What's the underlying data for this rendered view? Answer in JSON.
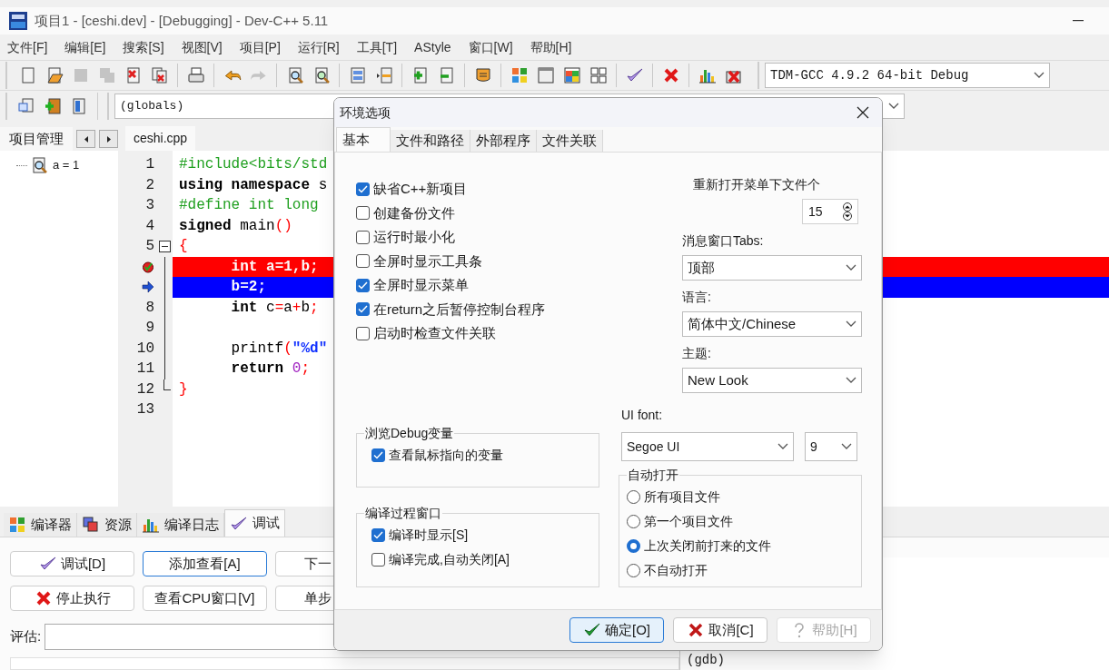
{
  "window": {
    "title": "项目1 - [ceshi.dev] - [Debugging] - Dev-C++ 5.11"
  },
  "menu": [
    "文件[F]",
    "编辑[E]",
    "搜索[S]",
    "视图[V]",
    "项目[P]",
    "运行[R]",
    "工具[T]",
    "AStyle",
    "窗口[W]",
    "帮助[H]"
  ],
  "toolbar_main": {
    "groups": [
      [
        {
          "kind": "new",
          "disabled": false
        },
        {
          "kind": "open",
          "disabled": false
        },
        {
          "kind": "save",
          "disabled": true
        },
        {
          "kind": "save-all",
          "disabled": true
        },
        {
          "kind": "close",
          "disabled": false
        },
        {
          "kind": "close-all",
          "disabled": false
        }
      ],
      [
        {
          "kind": "print",
          "disabled": false
        }
      ],
      [
        {
          "kind": "undo",
          "disabled": false
        },
        {
          "kind": "redo",
          "disabled": true
        }
      ],
      [
        {
          "kind": "find",
          "disabled": false
        },
        {
          "kind": "replace",
          "disabled": false
        }
      ],
      [
        {
          "kind": "panel",
          "disabled": false
        },
        {
          "kind": "split",
          "disabled": false
        }
      ],
      [
        {
          "kind": "add",
          "disabled": false
        },
        {
          "kind": "remove",
          "disabled": false
        }
      ],
      [
        {
          "kind": "bookmark",
          "disabled": false
        }
      ],
      [
        {
          "kind": "grid",
          "disabled": false
        },
        {
          "kind": "window",
          "disabled": false
        },
        {
          "kind": "colors",
          "disabled": false
        },
        {
          "kind": "tiles",
          "disabled": false
        }
      ],
      [
        {
          "kind": "check",
          "disabled": false
        }
      ],
      [
        {
          "kind": "cross",
          "disabled": false
        }
      ],
      [
        {
          "kind": "chart",
          "disabled": false
        },
        {
          "kind": "chart-cross",
          "disabled": false
        }
      ]
    ],
    "compiler_select": {
      "value": "TDM-GCC 4.9.2 64-bit Debug"
    }
  },
  "toolbar_secondary": {
    "buttons": [
      {
        "kind": "copy"
      },
      {
        "kind": "add-orange"
      },
      {
        "kind": "panel-blue"
      }
    ],
    "scope_select": {
      "value": "(globals)"
    }
  },
  "project_panel": {
    "tab": "项目管理",
    "watch_items": [
      {
        "label": "a = 1"
      }
    ]
  },
  "editor": {
    "tabs": [
      {
        "label": "ceshi.cpp",
        "selected": true
      }
    ],
    "lines": [
      {
        "kind": "normal",
        "number": "1",
        "segments": [
          {
            "kind": "preprocessor",
            "text": "#include<bits/std"
          }
        ]
      },
      {
        "kind": "normal",
        "number": "2",
        "segments": [
          {
            "kind": "keyword",
            "text": "using namespace"
          },
          {
            "kind": "plain",
            "text": " s"
          }
        ]
      },
      {
        "kind": "normal",
        "number": "3",
        "segments": [
          {
            "kind": "preprocessor",
            "text": "#define int long"
          }
        ]
      },
      {
        "kind": "normal",
        "number": "4",
        "segments": [
          {
            "kind": "keyword",
            "text": "signed"
          },
          {
            "kind": "plain",
            "text": " main"
          },
          {
            "kind": "symbol",
            "text": "()"
          }
        ]
      },
      {
        "kind": "fold-start",
        "number": "5",
        "segments": [
          {
            "kind": "symbol",
            "text": "{"
          }
        ]
      },
      {
        "kind": "breakpoint",
        "segments": [
          {
            "kind": "keyword",
            "text": "\tint"
          },
          {
            "kind": "plain",
            "text": " a=1,b;"
          }
        ]
      },
      {
        "kind": "execution",
        "segments": [
          {
            "kind": "plain",
            "text": "\tb=2;"
          }
        ]
      },
      {
        "kind": "normal",
        "number": "8",
        "segments": [
          {
            "kind": "keyword",
            "text": "\tint"
          },
          {
            "kind": "plain",
            "text": " c"
          },
          {
            "kind": "symbol",
            "text": "="
          },
          {
            "kind": "plain",
            "text": "a"
          },
          {
            "kind": "symbol",
            "text": "+"
          },
          {
            "kind": "plain",
            "text": "b"
          },
          {
            "kind": "symbol",
            "text": ";"
          }
        ]
      },
      {
        "kind": "normal",
        "number": "9"
      },
      {
        "kind": "normal",
        "number": "10",
        "segments": [
          {
            "kind": "plain",
            "text": "\tprintf"
          },
          {
            "kind": "symbol",
            "text": "("
          },
          {
            "kind": "string",
            "text": "\"%d\""
          }
        ]
      },
      {
        "kind": "normal",
        "number": "11",
        "segments": [
          {
            "kind": "keyword",
            "text": "\treturn "
          },
          {
            "kind": "number",
            "text": "0"
          },
          {
            "kind": "symbol",
            "text": ";"
          }
        ]
      },
      {
        "kind": "fold-end",
        "number": "12",
        "segments": [
          {
            "kind": "symbol",
            "text": "}"
          }
        ]
      },
      {
        "kind": "normal",
        "number": "13"
      }
    ]
  },
  "bottom_panel": {
    "tabs": [
      {
        "label": "编译器",
        "kind": "grid",
        "selected": false
      },
      {
        "label": "资源",
        "kind": "layers",
        "selected": false
      },
      {
        "label": "编译日志",
        "kind": "chart",
        "selected": false
      },
      {
        "label": "调试",
        "kind": "check",
        "selected": true
      }
    ],
    "buttons": [
      [
        {
          "label": "调试[D]",
          "kind": "check",
          "focused": false
        },
        {
          "label": "添加查看[A]",
          "kind": "text",
          "focused": true
        },
        {
          "label": "下一",
          "kind": "clipped",
          "focused": false
        }
      ],
      [
        {
          "label": "停止执行",
          "kind": "cross",
          "focused": false
        },
        {
          "label": "查看CPU窗口[V]",
          "kind": "text",
          "focused": false
        },
        {
          "label": "单步",
          "kind": "clipped",
          "focused": false
        }
      ]
    ],
    "evaluate": {
      "label": "评估:"
    },
    "output": [
      "(gdb)"
    ]
  },
  "dialog": {
    "title": "环境选项",
    "tabs": [
      {
        "label": "基本",
        "selected": true
      },
      {
        "label": "文件和路径",
        "selected": false
      },
      {
        "label": "外部程序",
        "selected": false
      },
      {
        "label": "文件关联",
        "selected": false
      }
    ],
    "options": [
      {
        "label": "缺省C++新项目",
        "checked": true
      },
      {
        "label": "创建备份文件",
        "checked": false
      },
      {
        "label": "运行时最小化",
        "checked": false
      },
      {
        "label": "全屏时显示工具条",
        "checked": false
      },
      {
        "label": "全屏时显示菜单",
        "checked": true
      },
      {
        "label": "在return之后暂停控制台程序",
        "checked": true
      },
      {
        "label": "启动时检查文件关联",
        "checked": false
      }
    ],
    "debug_group": {
      "title": "浏览Debug变量",
      "options": [
        {
          "label": "查看鼠标指向的变量",
          "checked": true
        }
      ]
    },
    "compile_group": {
      "title": "编译过程窗口",
      "options": [
        {
          "label": "编译时显示[S]",
          "checked": true
        },
        {
          "label": "编译完成,自动关闭[A]",
          "checked": false
        }
      ]
    },
    "reopen": {
      "label": "重新打开菜单下文件个",
      "value": "15"
    },
    "message_tabs": {
      "label": "消息窗口Tabs:",
      "value": "顶部"
    },
    "language": {
      "label": "语言:",
      "value": "简体中文/Chinese"
    },
    "theme": {
      "label": "主题:",
      "value": "New Look"
    },
    "ui_font": {
      "label": "UI font:",
      "value": "Segoe UI",
      "size": "9"
    },
    "auto_open": {
      "title": "自动打开",
      "options": [
        {
          "label": "所有项目文件",
          "selected": false
        },
        {
          "label": "第一个项目文件",
          "selected": false
        },
        {
          "label": "上次关闭前打来的文件",
          "selected": true
        },
        {
          "label": "不自动打开",
          "selected": false
        }
      ]
    },
    "buttons": [
      {
        "label": "确定[O]",
        "kind": "ok",
        "default": true,
        "disabled": false
      },
      {
        "label": "取消[C]",
        "kind": "cancel",
        "default": false,
        "disabled": false
      },
      {
        "label": "帮助[H]",
        "kind": "help",
        "default": false,
        "disabled": true
      }
    ]
  }
}
